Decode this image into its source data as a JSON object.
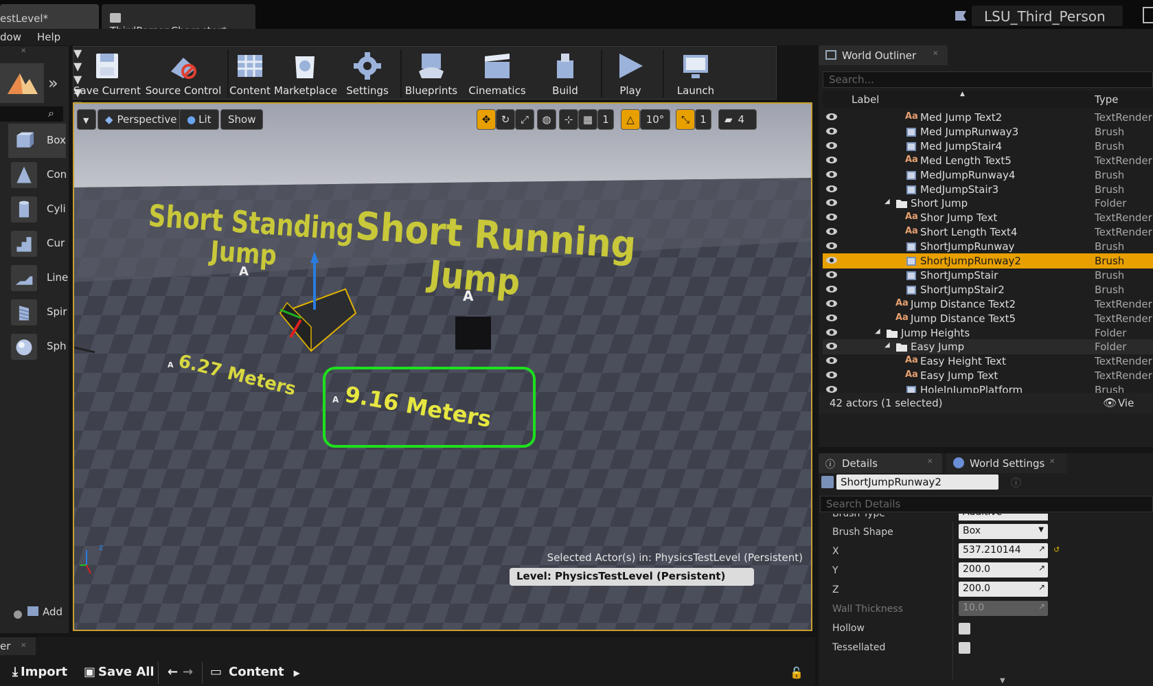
{
  "titlebar": {
    "tabs": [
      {
        "label": "estLevel*"
      },
      {
        "label": "ThirdPersonCharacter*"
      }
    ],
    "project_name": "LSU_Third_Person"
  },
  "menu": {
    "items": [
      "dow",
      "Help"
    ]
  },
  "left_panel": {
    "items": [
      {
        "label": "Box",
        "icon": "box-icon"
      },
      {
        "label": "Con",
        "icon": "cone-icon"
      },
      {
        "label": "Cyli",
        "icon": "cylinder-icon"
      },
      {
        "label": "Cur",
        "icon": "curved-stair-icon"
      },
      {
        "label": "Line",
        "icon": "linear-stair-icon"
      },
      {
        "label": "Spir",
        "icon": "spiral-stair-icon"
      },
      {
        "label": "Sph",
        "icon": "sphere-icon"
      }
    ],
    "add_label": "Add"
  },
  "toolbar": {
    "buttons": [
      {
        "label": "Save Current",
        "icon": "save-icon"
      },
      {
        "label": "Source Control",
        "icon": "source-control-icon"
      },
      {
        "label": "Content",
        "icon": "content-icon"
      },
      {
        "label": "Marketplace",
        "icon": "marketplace-icon"
      },
      {
        "label": "Settings",
        "icon": "settings-icon"
      },
      {
        "label": "Blueprints",
        "icon": "blueprints-icon"
      },
      {
        "label": "Cinematics",
        "icon": "cinematics-icon"
      },
      {
        "label": "Build",
        "icon": "build-icon"
      },
      {
        "label": "Play",
        "icon": "play-icon"
      },
      {
        "label": "Launch",
        "icon": "launch-icon"
      }
    ]
  },
  "viewport": {
    "perspective_label": "Perspective",
    "lit_label": "Lit",
    "show_label": "Show",
    "rotation_snap": "10°",
    "grid_snap": "1",
    "scale_snap": "1",
    "camera_speed": "4",
    "scene_texts": {
      "short_standing": "Short Standing",
      "jump1": "Jump",
      "short_running": "Short Running",
      "jump2": "Jump",
      "meters1": "6.27 Meters",
      "meters2": "9.16 Meters",
      "marker": "A"
    },
    "selected_actor_text": "Selected Actor(s) in:  PhysicsTestLevel (Persistent)",
    "level_text": "Level:  PhysicsTestLevel (Persistent)"
  },
  "world_outliner": {
    "tab_label": "World Outliner",
    "search_placeholder": "Search...",
    "columns": {
      "label": "Label",
      "type": "Type"
    },
    "rows": [
      {
        "label": "Med Jump Text2",
        "type": "TextRender",
        "icon": "text-render-icon",
        "indent": 2
      },
      {
        "label": "Med JumpRunway3",
        "type": "Brush",
        "icon": "brush-icon",
        "indent": 2
      },
      {
        "label": "Med JumpStair4",
        "type": "Brush",
        "icon": "brush-icon",
        "indent": 2
      },
      {
        "label": "Med Length Text5",
        "type": "TextRender",
        "icon": "text-render-icon",
        "indent": 2
      },
      {
        "label": "MedJumpRunway4",
        "type": "Brush",
        "icon": "brush-icon",
        "indent": 2
      },
      {
        "label": "MedJumpStair3",
        "type": "Brush",
        "icon": "brush-icon",
        "indent": 2
      },
      {
        "label": "Short Jump",
        "type": "Folder",
        "icon": "folder-icon",
        "indent": 1
      },
      {
        "label": "Shor Jump Text",
        "type": "TextRender",
        "icon": "text-render-icon",
        "indent": 2
      },
      {
        "label": "Short Length Text4",
        "type": "TextRender",
        "icon": "text-render-icon",
        "indent": 2
      },
      {
        "label": "ShortJumpRunway",
        "type": "Brush",
        "icon": "brush-icon",
        "indent": 2
      },
      {
        "label": "ShortJumpRunway2",
        "type": "Brush",
        "icon": "brush-icon",
        "indent": 2,
        "selected": true
      },
      {
        "label": "ShortJumpStair",
        "type": "Brush",
        "icon": "brush-icon",
        "indent": 2
      },
      {
        "label": "ShortJumpStair2",
        "type": "Brush",
        "icon": "brush-icon",
        "indent": 2
      },
      {
        "label": "Jump Distance Text2",
        "type": "TextRender",
        "icon": "text-render-icon",
        "indent": 1
      },
      {
        "label": "Jump Distance Text5",
        "type": "TextRender",
        "icon": "text-render-icon",
        "indent": 1
      },
      {
        "label": "Jump Heights",
        "type": "Folder",
        "icon": "folder-icon",
        "indent": 0
      },
      {
        "label": "Easy Jump",
        "type": "Folder",
        "icon": "folder-icon",
        "indent": 1
      },
      {
        "label": "Easy Height Text",
        "type": "TextRender",
        "icon": "text-render-icon",
        "indent": 2
      },
      {
        "label": "Easy Jump Text",
        "type": "TextRender",
        "icon": "text-render-icon",
        "indent": 2
      },
      {
        "label": "HoleInJumpPlatform",
        "type": "Brush",
        "icon": "brush-icon",
        "indent": 2
      }
    ],
    "actor_count": "42 actors (1 selected)",
    "view_options": "Vie"
  },
  "details": {
    "tab_label": "Details",
    "world_settings_label": "World Settings",
    "actor_name": "ShortJumpRunway2",
    "search_placeholder": "Search Details",
    "partial_label": "Brush Type",
    "partial_value": "Additive",
    "properties": [
      {
        "label": "Brush Shape",
        "value": "Box",
        "kind": "dropdown"
      },
      {
        "label": "X",
        "value": "537.210144",
        "kind": "number"
      },
      {
        "label": "Y",
        "value": "200.0",
        "kind": "number"
      },
      {
        "label": "Z",
        "value": "200.0",
        "kind": "number"
      },
      {
        "label": "Wall Thickness",
        "value": "10.0",
        "kind": "number-disabled"
      },
      {
        "label": "Hollow",
        "value": "",
        "kind": "checkbox"
      },
      {
        "label": "Tessellated",
        "value": "",
        "kind": "checkbox"
      }
    ]
  },
  "content_browser": {
    "tab_label": "er",
    "import_label": "Import",
    "save_all_label": "Save All",
    "path_label": "Content"
  },
  "colors": {
    "selection": "#e8a000",
    "accent_gold": "#c8a030",
    "highlight_green": "#22dd22",
    "scene_text": "#d6d640"
  }
}
